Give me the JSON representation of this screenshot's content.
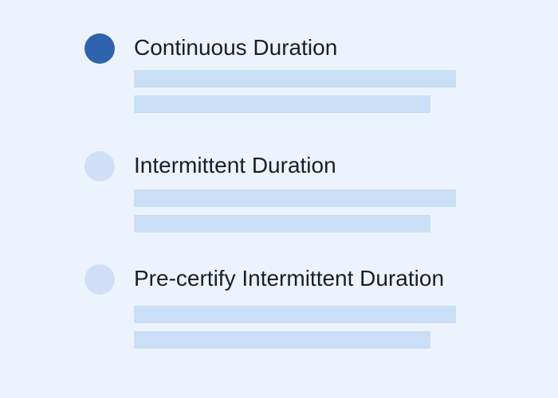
{
  "options": [
    {
      "label": "Continuous Duration",
      "selected": true
    },
    {
      "label": "Intermittent Duration",
      "selected": false
    },
    {
      "label": "Pre-certify Intermittent Duration",
      "selected": false
    }
  ],
  "colors": {
    "background": "#edf3fd",
    "radio_selected": "#2f63ad",
    "radio_unselected": "#cfe0f6",
    "placeholder_bar": "#cadef6",
    "text": "#1b1e24"
  }
}
